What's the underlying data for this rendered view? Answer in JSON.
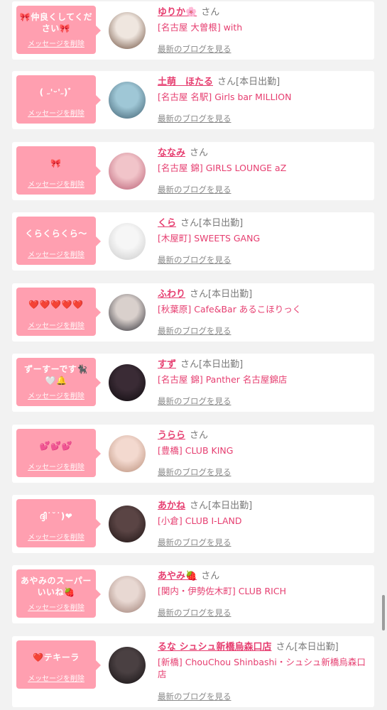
{
  "delete_label": "メッセージを削除",
  "blog_label": "最新のブログを見る",
  "san_label": "さん",
  "items": [
    {
      "message": "🎀仲良くしてください🎀",
      "name": "ゆりか🌸",
      "status": "",
      "shop": "[名古屋 大曽根] with",
      "avatar_colors": [
        "#efe6df",
        "#6b4c3a"
      ]
    },
    {
      "message": "( ˶'ᵕ'˶)ﾞ",
      "name": "土萌　ほたる",
      "status": "[本日出勤]",
      "shop": "[名古屋 名駅] Girls bar MILLION",
      "avatar_colors": [
        "#9fc7d6",
        "#3d5d6e"
      ]
    },
    {
      "message": "🎀",
      "name": "ななみ",
      "status": "",
      "shop": "[名古屋 錦] GIRLS LOUNGE aZ",
      "avatar_colors": [
        "#f1c4c9",
        "#b85c72"
      ]
    },
    {
      "message": "くらくらくら〜",
      "name": "くら",
      "status": "[本日出勤]",
      "shop": "[木屋町] SWEETS GANG",
      "avatar_colors": [
        "#f6f6f6",
        "#c9c9c9"
      ]
    },
    {
      "message": "❤️❤️❤️❤️❤️",
      "name": "ふわり",
      "status": "[本日出勤]",
      "shop": "[秋葉原] Cafe&Bar あるこほりっく",
      "avatar_colors": [
        "#d9d0cc",
        "#2b2b33"
      ]
    },
    {
      "message": "ずーすーです🐈‍⬛🤍🔔",
      "name": "すず",
      "status": "[本日出勤]",
      "shop": "[名古屋 錦] Panther 名古屋錦店",
      "avatar_colors": [
        "#3a2b35",
        "#0d0a0d"
      ]
    },
    {
      "message": "💕💕💕",
      "name": "うらら",
      "status": "",
      "shop": "[豊橋] CLUB KING",
      "avatar_colors": [
        "#f3d9cf",
        "#b88d78"
      ]
    },
    {
      "message": "ദ്ദി˙˘˙)❤",
      "name": "あかね",
      "status": "[本日出勤]",
      "shop": "[小倉] CLUB I-LAND",
      "avatar_colors": [
        "#5a4444",
        "#1d1313"
      ]
    },
    {
      "message": "あやみのスーパーいいね🍓",
      "name": "あやみ🍓",
      "status": "",
      "shop": "[関内・伊勢佐木町] CLUB RICH",
      "avatar_colors": [
        "#e8d8d2",
        "#9c7c72"
      ]
    },
    {
      "message": "❤️テキーラ",
      "name": "るな シュシュ新橋烏森口店",
      "status": "[本日出勤]",
      "shop": "[新橋] ChouChou Shinbashi・シュシュ新橋烏森口店",
      "avatar_colors": [
        "#4a4042",
        "#141012"
      ]
    }
  ]
}
